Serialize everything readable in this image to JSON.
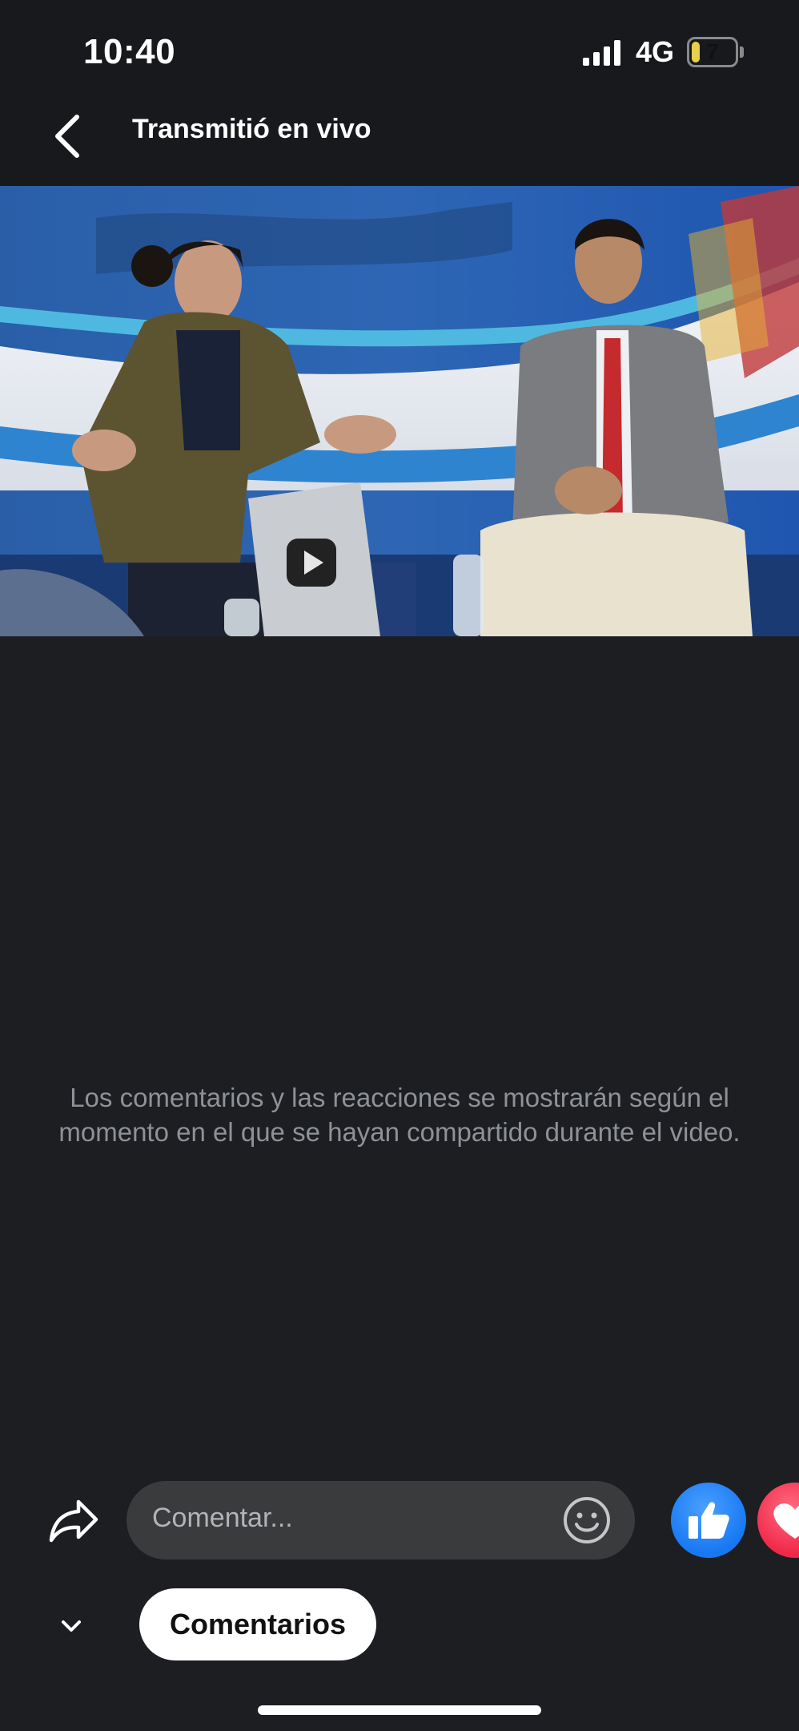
{
  "status_bar": {
    "time": "10:40",
    "network": "4G",
    "battery_level": "7",
    "battery_color": "#e9d04a"
  },
  "header": {
    "back_icon": "chevron-left-icon",
    "title": "Transmitió en vivo"
  },
  "video": {
    "description_icon": "video-player"
  },
  "comments_area": {
    "empty_message": "Los comentarios y las reacciones se mostrarán según el momento en el que se hayan compartido durante el video."
  },
  "composer": {
    "share_icon": "share-arrow-icon",
    "placeholder": "Comentar...",
    "emoji_icon": "smiley-icon",
    "like_icon": "thumbs-up-icon",
    "love_icon": "heart-icon",
    "like_color": "#1778f2",
    "love_color": "#f02849"
  },
  "footer": {
    "collapse_icon": "chevron-down-icon",
    "tab_label": "Comentarios"
  }
}
